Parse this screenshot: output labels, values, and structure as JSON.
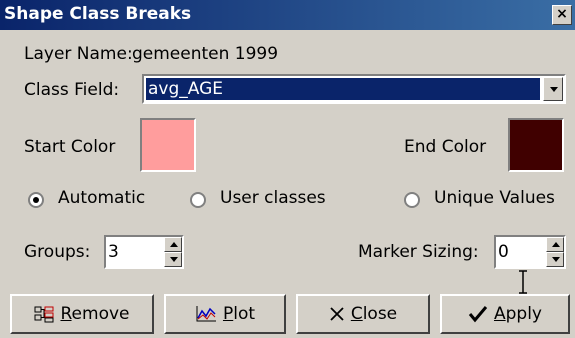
{
  "window": {
    "title": "Shape Class Breaks",
    "close_label": "×"
  },
  "layer": {
    "label": "Layer Name:",
    "value": "gemeenten 1999"
  },
  "class_field": {
    "label": "Class Field:",
    "value": "avg_AGE"
  },
  "colors": {
    "start_label": "Start Color",
    "start_value": "#ff9d9d",
    "end_label": "End Color",
    "end_value": "#400000"
  },
  "mode": {
    "options": [
      {
        "label": "Automatic",
        "selected": true
      },
      {
        "label": "User classes",
        "selected": false
      },
      {
        "label": "Unique Values",
        "selected": false
      }
    ]
  },
  "groups": {
    "label": "Groups:",
    "value": "3"
  },
  "marker_sizing": {
    "label": "Marker Sizing:",
    "value": "0"
  },
  "buttons": {
    "remove_prefix": "",
    "remove_mnemonic": "R",
    "remove_rest": "emove",
    "plot_mnemonic": "P",
    "plot_rest": "lot",
    "close_mnemonic": "C",
    "close_rest": "lose",
    "apply_mnemonic": "A",
    "apply_rest": "pply"
  },
  "icons": {
    "remove": "remove-classes-icon",
    "plot": "plot-chart-icon",
    "close": "x-close-icon",
    "apply": "checkmark-icon",
    "combo": "chevron-down-icon",
    "spin_up": "spin-up-icon",
    "spin_down": "spin-down-icon"
  }
}
